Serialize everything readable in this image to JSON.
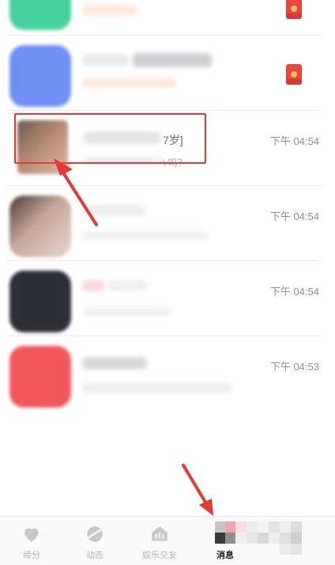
{
  "conversations": [
    {
      "time": ""
    },
    {
      "time": ""
    },
    {
      "time": "下午 04:54",
      "name_fragment": "7岁]",
      "preview_fragment": "\\ 吗？"
    },
    {
      "time": "下午 04:54"
    },
    {
      "time": "下午 04:54"
    },
    {
      "time": "下午 04:53"
    }
  ],
  "tabbar": {
    "items": [
      {
        "label": "缘分",
        "icon": "heart-icon"
      },
      {
        "label": "动态",
        "icon": "planet-icon"
      },
      {
        "label": "娱乐交友",
        "icon": "radio-icon"
      },
      {
        "label": "消息",
        "icon": "message-icon"
      }
    ]
  },
  "colors": {
    "highlight": "#e53935",
    "arrow": "#e53935",
    "active_tab": "#222222",
    "inactive_tab": "#b5b5b5"
  }
}
